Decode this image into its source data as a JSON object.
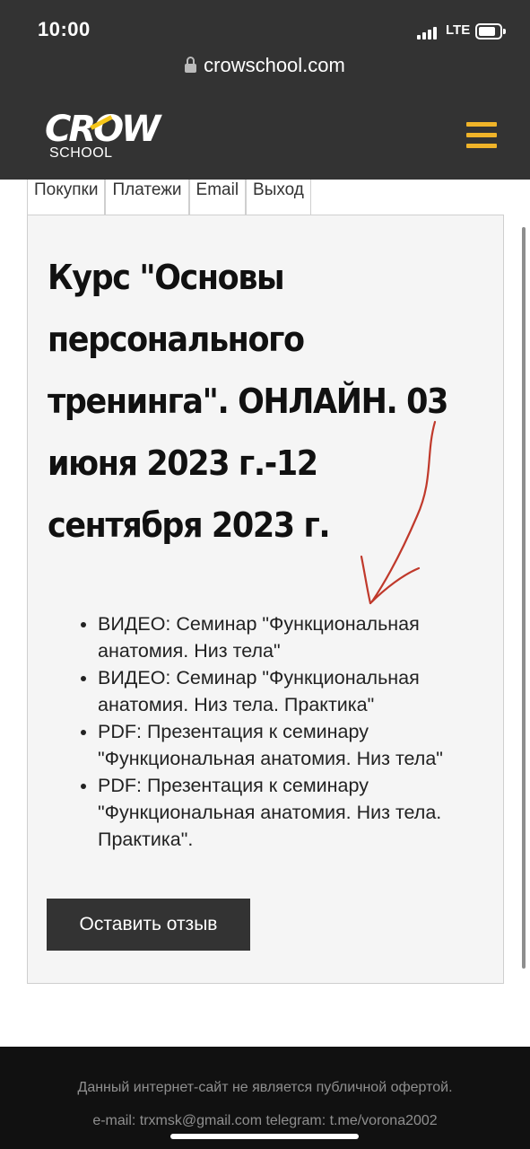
{
  "status_bar": {
    "time": "10:00",
    "network": "LTE"
  },
  "browser": {
    "url": "crowschool.com"
  },
  "header": {
    "logo_text": "CROW",
    "logo_subtext": "SCHOOL",
    "menu_icon": "hamburger-menu-icon",
    "menu_color": "#f0b429"
  },
  "tabs": [
    {
      "label": "Покупки"
    },
    {
      "label": "Платежи"
    },
    {
      "label": "Email"
    },
    {
      "label": "Выход"
    }
  ],
  "course": {
    "title": "Курс \"Основы персонального тренинга\". ОНЛАЙН. 03 июня 2023 г.-12 сентября 2023 г.",
    "materials": [
      "ВИДЕО: Семинар \"Функциональная анатомия. Низ тела\"",
      "ВИДЕО: Семинар \"Функциональная анатомия. Низ тела. Практика\"",
      "PDF: Презентация к семинару \"Функциональная анатомия. Низ тела\"",
      "PDF: Презентация к семинару \"Функциональная анатомия. Низ тела. Практика\"."
    ],
    "review_button": "Оставить отзыв"
  },
  "annotation": {
    "type": "hand-drawn-arrow",
    "color": "#c0392b"
  },
  "footer": {
    "disclaimer": "Данный интернет-сайт не является публичной офертой.",
    "contacts": "e-mail: trxmsk@gmail.com telegram: t.me/vorona2002"
  }
}
